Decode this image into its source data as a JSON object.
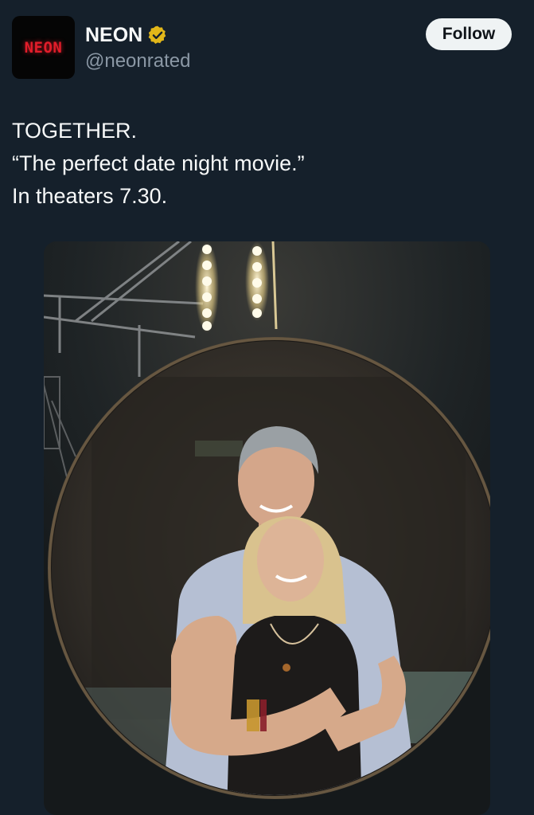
{
  "author": {
    "avatar_text": "NEON",
    "display_name": "NEON",
    "handle": "@neonrated",
    "verified": true,
    "verified_color": "#e2b719"
  },
  "follow_button": {
    "label": "Follow"
  },
  "tweet": {
    "lines": [
      "TOGETHER.",
      "“The perfect date night movie.”",
      "In theaters 7.30."
    ]
  },
  "media": {
    "type": "video-still",
    "description_icon": "photo-media"
  },
  "colors": {
    "background": "#15202b",
    "text_primary": "#f7f9f9",
    "text_secondary": "#8b98a5",
    "button_bg": "#eff3f4",
    "button_text": "#0f1419",
    "brand_red": "#e11d2a"
  }
}
